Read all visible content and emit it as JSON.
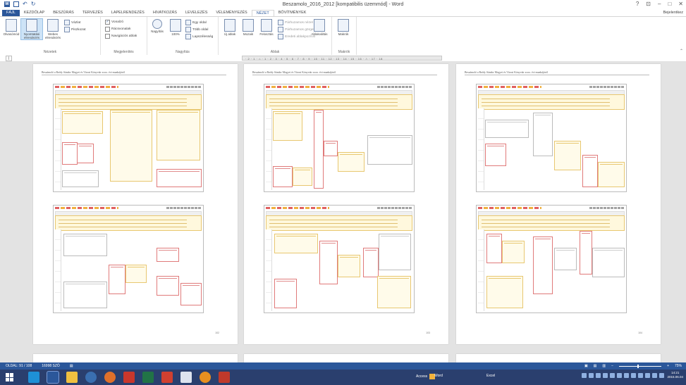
{
  "window": {
    "title": "Beszamolo_2016_2012 [kompatibilis üzemmód] - Word",
    "controls": [
      "?",
      "⊡",
      "–",
      "□",
      "✕"
    ]
  },
  "quick_access": {
    "undo": "↶",
    "redo": "↻"
  },
  "tabs": [
    "FÁJL",
    "KEZDŐLAP",
    "BESZÚRÁS",
    "TERVEZÉS",
    "LAPELRENDEZÉS",
    "HIVATKOZÁS",
    "LEVELEZÉS",
    "VÉLEMÉNYEZÉS",
    "NÉZET",
    "BŐVÍTMÉNYEK"
  ],
  "active_tab": "NÉZET",
  "signin": "Bejelentkez",
  "ribbon": {
    "nezetek": {
      "label": "Nézetek",
      "olvasomod": "Olvasómód",
      "nyomtatasi": "Nyomtatási elrendezés",
      "webes": "Webes elrendezés",
      "vazlat": "Vázlat",
      "piszkozat": "Piszkozat"
    },
    "megjelenites": {
      "label": "Megjelenítés",
      "vonalzo": "Vonalzó",
      "racsvonalak": "Rácsvonalak",
      "navigacios": "Navigációs ablak"
    },
    "nagyitas": {
      "label": "Nagyítás",
      "nagyitas": "Nagyítás",
      "szazalek": "100%",
      "egy_oldal": "Egy oldal",
      "tobb_oldal": "Több oldal",
      "lapszelesseg": "Lapszélesség"
    },
    "ablak": {
      "label": "Ablak",
      "uj_ablak": "Új ablak",
      "mozaik": "Mozaik",
      "felosztas": "Felosztás",
      "parhuzamos": "Párhuzamos nézet",
      "gorgetes": "Párhuzamos görgetés",
      "visszaallitas": "Eredeti ablakpozíció",
      "ablakvaltas": "Ablakváltás"
    },
    "makrok": {
      "label": "Makrók",
      "makrok": "Makrók"
    }
  },
  "ruler_text": "· 2 · 1 · ⌂ · 1 · 2 · 3 · 4 · 5 · 6 · 7 · 8 · 9 · 10 · 11 · 12 · 13 · 14 · 15 · 16 · △ · 17 · 18",
  "pages": [
    {
      "header": "Beszámoló a Bródy Sándor Megyei és Városi Könyvtár xxxx. évi munkájáról",
      "number": "102"
    },
    {
      "header": "Beszámoló a Bródy Sándor Megyei és Városi Könyvtár xxxx. évi munkájáról",
      "number": "103"
    },
    {
      "header": "Beszámoló a Bródy Sándor Megyei és Városi Könyvtár xxxx. évi munkájáról",
      "number": "104"
    }
  ],
  "status": {
    "page": "OLDAL: 91 / 108",
    "words": "16998 SZÓ",
    "zoom": "75%"
  },
  "taskbar": {
    "apps": [
      "Access",
      "Word",
      "Excel"
    ],
    "clock_time": "14:21",
    "clock_date": "2015.06.04"
  },
  "colors": {
    "accent": "#2b579a",
    "taskbar": "#2a3f6e",
    "doc_bg": "#e3e3e3"
  }
}
